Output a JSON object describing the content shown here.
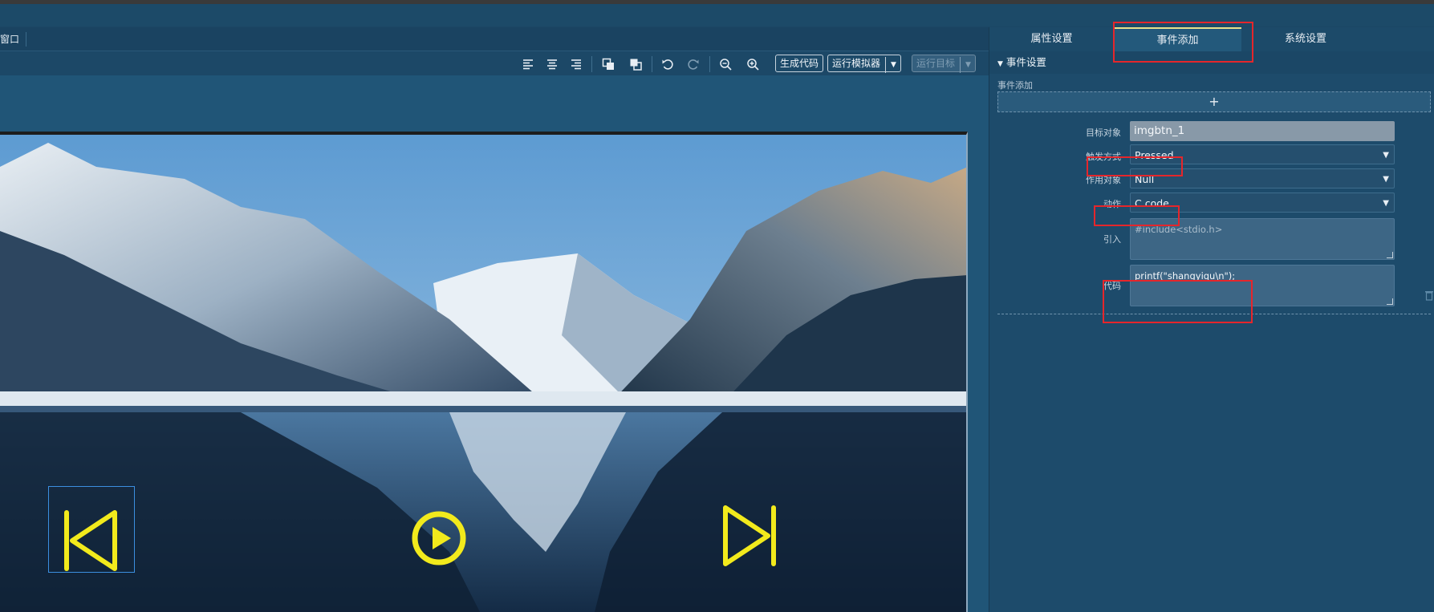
{
  "menu": {
    "window_label": "窗口"
  },
  "toolbar": {
    "icons": [
      "align-left-icon",
      "align-center-icon",
      "align-right-icon",
      "bring-forward-icon",
      "send-backward-icon",
      "undo-icon",
      "redo-icon",
      "zoom-out-icon",
      "zoom-in-icon"
    ],
    "generate_code_label": "生成代码",
    "run_simulator_label": "运行模拟器",
    "run_target_label": "运行目标"
  },
  "canvas": {
    "media_buttons": [
      "previous-icon",
      "play-icon",
      "next-icon"
    ],
    "media_color": "#f2ea1c"
  },
  "panel": {
    "tabs": [
      {
        "label": "属性设置",
        "active": false
      },
      {
        "label": "事件添加",
        "active": true
      },
      {
        "label": "系统设置",
        "active": false
      }
    ],
    "section_title": "事件设置",
    "event_add_label": "事件添加",
    "add_button_label": "+",
    "fields": {
      "target": {
        "label": "目标对象",
        "value": "imgbtn_1"
      },
      "trigger": {
        "label": "触发方式",
        "value": "Pressed"
      },
      "object": {
        "label": "作用对象",
        "value": "Null"
      },
      "action": {
        "label": "动作",
        "value": "C code..."
      },
      "include": {
        "label": "引入",
        "placeholder": "#include<stdio.h>"
      },
      "code": {
        "label": "代码",
        "value": "printf(\"shangyiqu\\n\");"
      }
    }
  },
  "colors": {
    "accent_tab": "#e8df8a",
    "highlight_box": "#e5262b",
    "selection": "#3b8fe0"
  }
}
